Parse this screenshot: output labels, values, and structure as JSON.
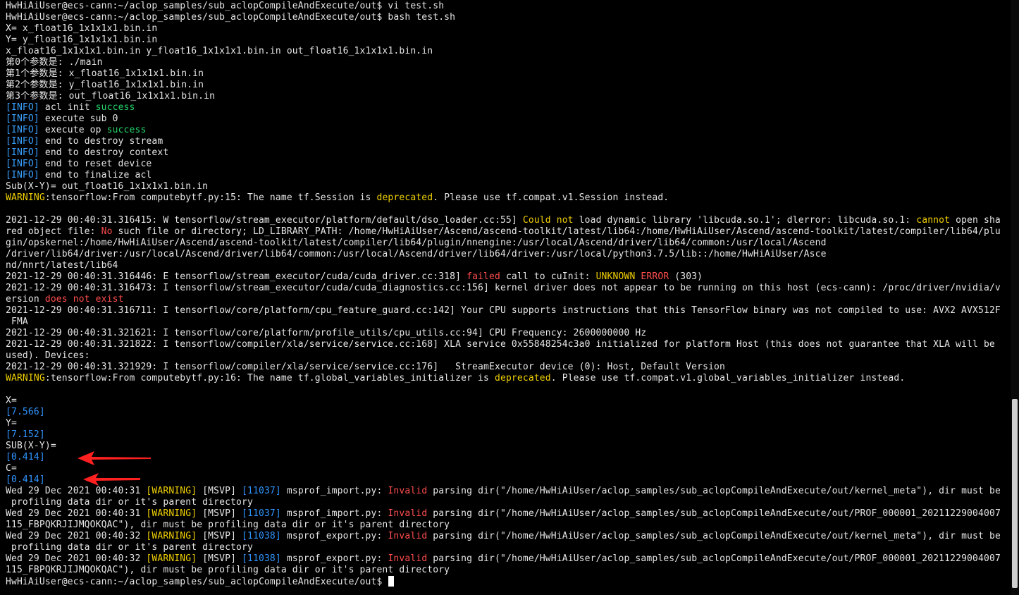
{
  "colors": {
    "background": "#000000",
    "default": "#e6e6e6",
    "info": "#3aa0ff",
    "success": "#24d46a",
    "warning": "#f0d000",
    "error": "#ff4d4d",
    "value": "#2f95ff",
    "arrow": "#ff2020",
    "scroll_thumb": "#cfcfcf"
  },
  "terminal": {
    "lines": [
      [
        {
          "t": "HwHiAiUser@ecs-cann:~/aclop_samples/sub_aclopCompileAndExecute/out$ vi test.sh"
        }
      ],
      [
        {
          "t": "HwHiAiUser@ecs-cann:~/aclop_samples/sub_aclopCompileAndExecute/out$ bash test.sh"
        }
      ],
      [
        {
          "t": "X= x_float16_1x1x1x1.bin.in"
        }
      ],
      [
        {
          "t": "Y= y_float16_1x1x1x1.bin.in"
        }
      ],
      [
        {
          "t": "x_float16_1x1x1x1.bin.in y_float16_1x1x1x1.bin.in out_float16_1x1x1x1.bin.in"
        }
      ],
      [
        {
          "t": "第0个参数是: ./main"
        }
      ],
      [
        {
          "t": "第1个参数是: x_float16_1x1x1x1.bin.in"
        }
      ],
      [
        {
          "t": "第2个参数是: y_float16_1x1x1x1.bin.in"
        }
      ],
      [
        {
          "t": "第3个参数是: out_float16_1x1x1x1.bin.in"
        }
      ],
      [
        {
          "t": "[INFO]",
          "c": "info"
        },
        {
          "t": " acl init "
        },
        {
          "t": "success",
          "c": "success"
        }
      ],
      [
        {
          "t": "[INFO]",
          "c": "info"
        },
        {
          "t": " execute sub 0"
        }
      ],
      [
        {
          "t": "[INFO]",
          "c": "info"
        },
        {
          "t": " execute op "
        },
        {
          "t": "success",
          "c": "success"
        }
      ],
      [
        {
          "t": "[INFO]",
          "c": "info"
        },
        {
          "t": " end to destroy stream"
        }
      ],
      [
        {
          "t": "[INFO]",
          "c": "info"
        },
        {
          "t": " end to destroy context"
        }
      ],
      [
        {
          "t": "[INFO]",
          "c": "info"
        },
        {
          "t": " end to reset device"
        }
      ],
      [
        {
          "t": "[INFO]",
          "c": "info"
        },
        {
          "t": " end to finalize acl"
        }
      ],
      [
        {
          "t": "Sub(X-Y)= out_float16_1x1x1x1.bin.in"
        }
      ],
      [
        {
          "t": "WARNING",
          "c": "warning"
        },
        {
          "t": ":tensorflow:From computebytf.py:15: The name tf.Session is "
        },
        {
          "t": "deprecated",
          "c": "warning"
        },
        {
          "t": ". Please use tf.compat.v1.Session instead."
        }
      ],
      [
        {
          "t": ""
        }
      ],
      [
        {
          "t": "2021-12-29 00:40:31.316415: W tensorflow/stream_executor/platform/default/dso_loader.cc:55] "
        },
        {
          "t": "Could not",
          "c": "warning"
        },
        {
          "t": " load dynamic library 'libcuda.so.1'; dlerror: libcuda.so.1: "
        },
        {
          "t": "cannot",
          "c": "warning"
        },
        {
          "t": " open sha"
        }
      ],
      [
        {
          "t": "red object file: "
        },
        {
          "t": "No",
          "c": "error"
        },
        {
          "t": " such file or directory; LD_LIBRARY_PATH: /home/HwHiAiUser/Ascend/ascend-toolkit/latest/lib64:/home/HwHiAiUser/Ascend/ascend-toolkit/latest/compiler/lib64/plu"
        }
      ],
      [
        {
          "t": "gin/opskernel:/home/HwHiAiUser/Ascend/ascend-toolkit/latest/compiler/lib64/plugin/nnengine:/usr/local/Ascend/driver/lib64/common:/usr/local/Ascend"
        }
      ],
      [
        {
          "t": "/driver/lib64/driver:/usr/local/Ascend/driver/lib64/common:/usr/local/Ascend/driver/lib64/driver:/usr/local/python3.7.5/lib::/home/HwHiAiUser/Asce"
        }
      ],
      [
        {
          "t": "nd/nnrt/latest/lib64"
        }
      ],
      [
        {
          "t": "2021-12-29 00:40:31.316446: E tensorflow/stream_executor/cuda/cuda_driver.cc:318] "
        },
        {
          "t": "failed",
          "c": "error"
        },
        {
          "t": " call to cuInit: "
        },
        {
          "t": "UNKNOWN",
          "c": "warning"
        },
        {
          "t": " "
        },
        {
          "t": "ERROR",
          "c": "error"
        },
        {
          "t": " (303)"
        }
      ],
      [
        {
          "t": "2021-12-29 00:40:31.316473: I tensorflow/stream_executor/cuda/cuda_diagnostics.cc:156] kernel driver does not appear to be running on this host (ecs-cann): /proc/driver/nvidia/v"
        }
      ],
      [
        {
          "t": "ersion "
        },
        {
          "t": "does not exist",
          "c": "error"
        }
      ],
      [
        {
          "t": "2021-12-29 00:40:31.316711: I tensorflow/core/platform/cpu_feature_guard.cc:142] Your CPU supports instructions that this TensorFlow binary was not compiled to use: AVX2 AVX512F"
        }
      ],
      [
        {
          "t": " FMA"
        }
      ],
      [
        {
          "t": "2021-12-29 00:40:31.321621: I tensorflow/core/platform/profile_utils/cpu_utils.cc:94] CPU Frequency: 2600000000 Hz"
        }
      ],
      [
        {
          "t": "2021-12-29 00:40:31.321822: I tensorflow/compiler/xla/service/service.cc:168] XLA service 0x55848254c3a0 initialized for platform Host (this does not guarantee that XLA will be"
        }
      ],
      [
        {
          "t": "used). Devices:"
        }
      ],
      [
        {
          "t": "2021-12-29 00:40:31.321929: I tensorflow/compiler/xla/service/service.cc:176]   StreamExecutor device (0): Host, Default Version"
        }
      ],
      [
        {
          "t": "WARNING",
          "c": "warning"
        },
        {
          "t": ":tensorflow:From computebytf.py:16: The name tf.global_variables_initializer is "
        },
        {
          "t": "deprecated",
          "c": "warning"
        },
        {
          "t": ". Please use tf.compat.v1.global_variables_initializer instead."
        }
      ],
      [
        {
          "t": ""
        }
      ],
      [
        {
          "t": "X="
        }
      ],
      [
        {
          "t": "[7.566]",
          "c": "value"
        }
      ],
      [
        {
          "t": "Y="
        }
      ],
      [
        {
          "t": "[7.152]",
          "c": "value"
        }
      ],
      [
        {
          "t": "SUB(X-Y)="
        }
      ],
      [
        {
          "t": "[0.414]",
          "c": "value"
        }
      ],
      [
        {
          "t": "C="
        }
      ],
      [
        {
          "t": "[0.414]",
          "c": "value"
        }
      ],
      [
        {
          "t": "Wed 29 Dec 2021 00:40:31 "
        },
        {
          "t": "[WARNING]",
          "c": "warning"
        },
        {
          "t": " [MSVP] "
        },
        {
          "t": "[11037]",
          "c": "value"
        },
        {
          "t": " msprof_import.py: "
        },
        {
          "t": "Invalid",
          "c": "error"
        },
        {
          "t": " parsing dir(\"/home/HwHiAiUser/aclop_samples/sub_aclopCompileAndExecute/out/kernel_meta\"), dir must be"
        }
      ],
      [
        {
          "t": " profiling data dir or it's parent directory"
        }
      ],
      [
        {
          "t": "Wed 29 Dec 2021 00:40:31 "
        },
        {
          "t": "[WARNING]",
          "c": "warning"
        },
        {
          "t": " [MSVP] "
        },
        {
          "t": "[11037]",
          "c": "value"
        },
        {
          "t": " msprof_import.py: "
        },
        {
          "t": "Invalid",
          "c": "error"
        },
        {
          "t": " parsing dir(\"/home/HwHiAiUser/aclop_samples/sub_aclopCompileAndExecute/out/PROF_000001_20211229004007"
        }
      ],
      [
        {
          "t": "115_FBPQKRJIJMQOKQAC\"), dir must be profiling data dir or it's parent directory"
        }
      ],
      [
        {
          "t": "Wed 29 Dec 2021 00:40:32 "
        },
        {
          "t": "[WARNING]",
          "c": "warning"
        },
        {
          "t": " [MSVP] "
        },
        {
          "t": "[11038]",
          "c": "value"
        },
        {
          "t": " msprof_export.py: "
        },
        {
          "t": "Invalid",
          "c": "error"
        },
        {
          "t": " parsing dir(\"/home/HwHiAiUser/aclop_samples/sub_aclopCompileAndExecute/out/kernel_meta\"), dir must be"
        }
      ],
      [
        {
          "t": " profiling data dir or it's parent directory"
        }
      ],
      [
        {
          "t": "Wed 29 Dec 2021 00:40:32 "
        },
        {
          "t": "[WARNING]",
          "c": "warning"
        },
        {
          "t": " [MSVP] "
        },
        {
          "t": "[11038]",
          "c": "value"
        },
        {
          "t": " msprof_export.py: "
        },
        {
          "t": "Invalid",
          "c": "error"
        },
        {
          "t": " parsing dir(\"/home/HwHiAiUser/aclop_samples/sub_aclopCompileAndExecute/out/PROF_000001_20211229004007"
        }
      ],
      [
        {
          "t": "115_FBPQKRJIJMQOKQAC\"), dir must be profiling data dir or it's parent directory"
        }
      ],
      [
        {
          "t": "HwHiAiUser@ecs-cann:~/aclop_samples/sub_aclopCompileAndExecute/out$ "
        }
      ]
    ],
    "cursor_line": 51
  },
  "annotations": {
    "arrows": [
      {
        "name": "arrow-sub-result",
        "points_to_line": 40
      },
      {
        "name": "arrow-c-result",
        "points_to_line": 42
      }
    ]
  }
}
